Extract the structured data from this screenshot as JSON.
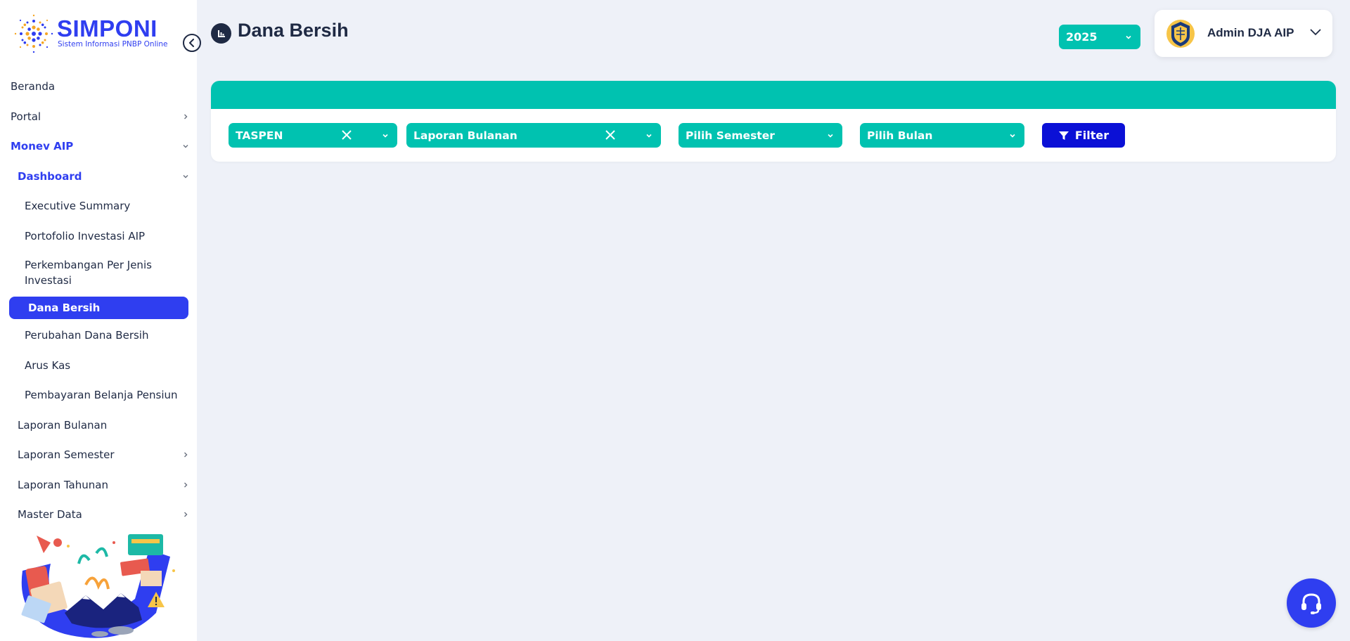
{
  "app": {
    "logo_title": "SIMPONI",
    "logo_subtitle": "Sistem Informasi PNBP Online"
  },
  "sidebar": {
    "items": [
      {
        "label": "Beranda"
      },
      {
        "label": "Portal"
      },
      {
        "label": "Monev AIP"
      },
      {
        "label": "Dashboard"
      },
      {
        "label": "Executive Summary"
      },
      {
        "label": "Portofolio Investasi AIP"
      },
      {
        "label": "Perkembangan Per Jenis Investasi"
      },
      {
        "label": "Dana Bersih"
      },
      {
        "label": "Perubahan Dana Bersih"
      },
      {
        "label": "Arus Kas"
      },
      {
        "label": "Pembayaran Belanja Pensiun"
      },
      {
        "label": "Laporan Bulanan"
      },
      {
        "label": "Laporan Semester"
      },
      {
        "label": "Laporan Tahunan"
      },
      {
        "label": "Master Data"
      }
    ]
  },
  "header": {
    "title": "Dana Bersih",
    "year": "2025",
    "user_name": "Admin DJA AIP"
  },
  "filters": {
    "institution": "TASPEN",
    "report_type": "Laporan Bulanan",
    "semester_placeholder": "Pilih Semester",
    "month_placeholder": "Pilih Bulan",
    "filter_label": "Filter"
  },
  "colors": {
    "primary": "#2f3ef0",
    "teal": "#00c2b0",
    "filter_button": "#0b10d6",
    "background": "#eef1f8",
    "text": "#1f2a44"
  }
}
